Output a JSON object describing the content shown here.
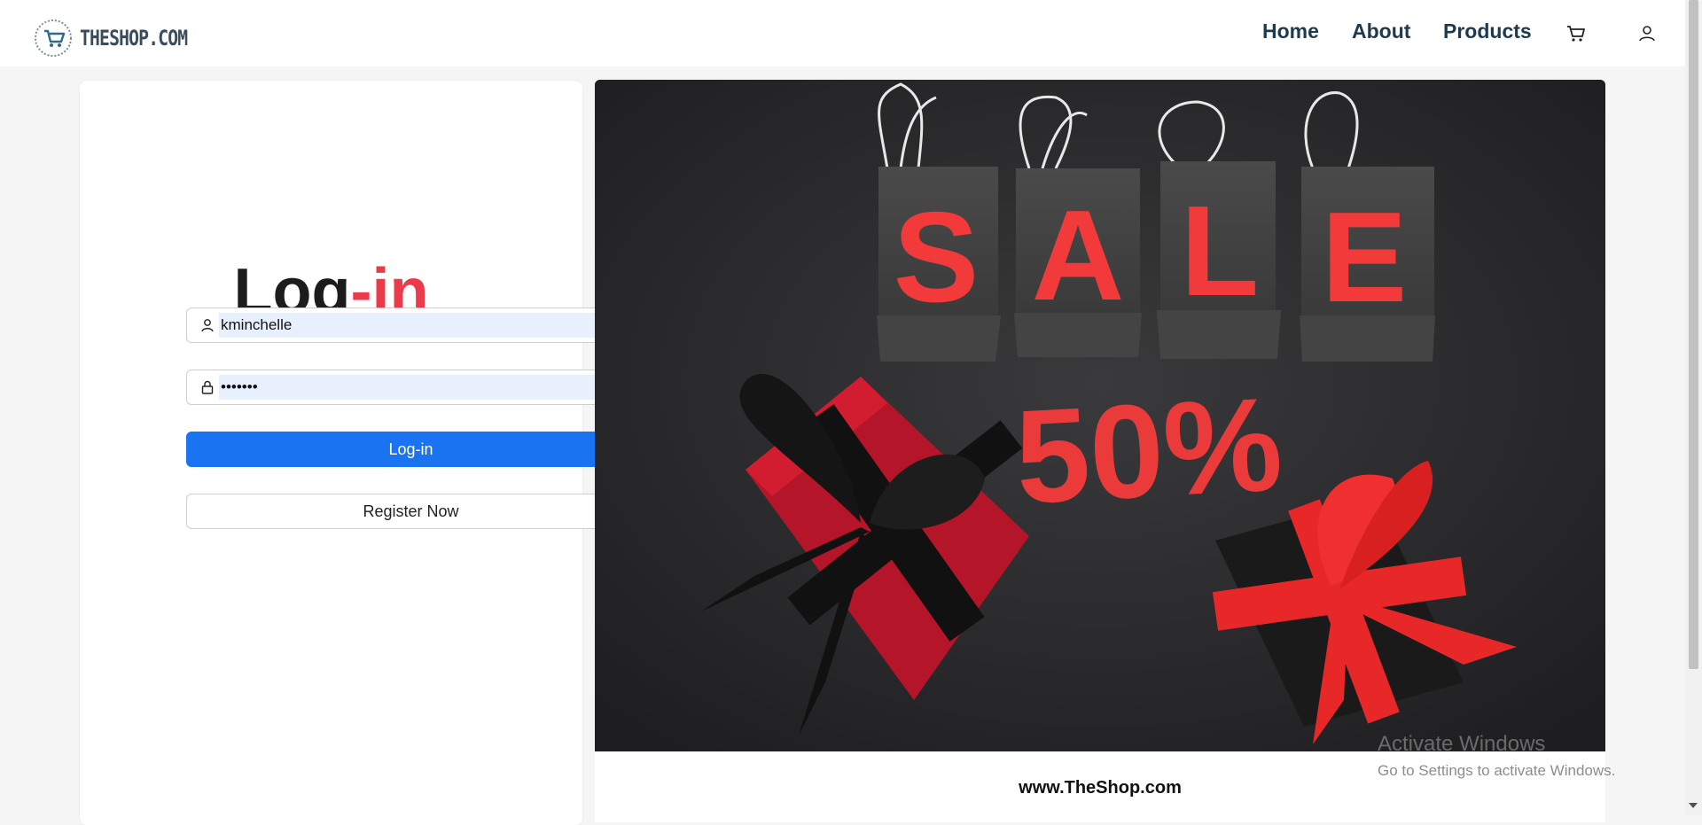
{
  "navbar": {
    "logo_text": "THESHOP.COM",
    "links": [
      "Home",
      "About",
      "Products"
    ],
    "cart_icon": "cart-icon",
    "user_icon": "user-icon"
  },
  "login": {
    "title_part1": "Log",
    "title_part2": "-in",
    "username_value": "kminchelle",
    "password_value": "•••••••",
    "login_button": "Log-in",
    "register_button": "Register Now",
    "accent_color": "#ec3a4b",
    "primary_color": "#1a73f0"
  },
  "promo": {
    "sale_letters": [
      "S",
      "A",
      "L",
      "E"
    ],
    "discount": "50%",
    "url": "www.TheShop.com"
  },
  "watermark": {
    "title": "Activate Windows",
    "subtitle": "Go to Settings to activate Windows."
  }
}
